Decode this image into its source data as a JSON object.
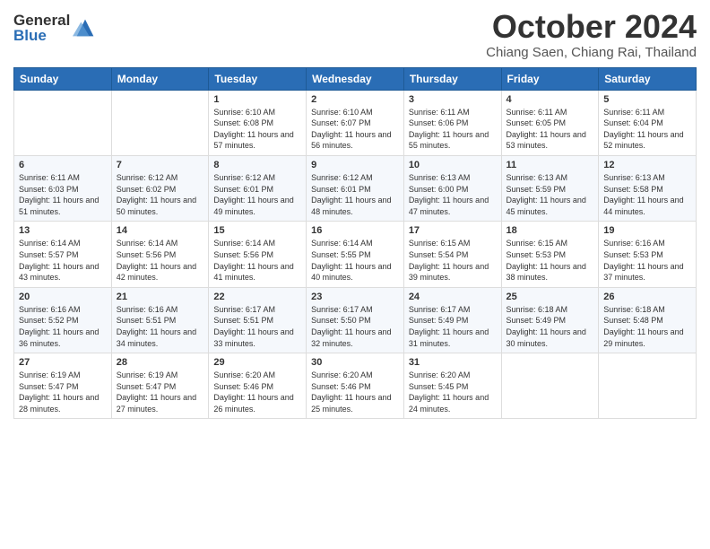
{
  "header": {
    "logo_general": "General",
    "logo_blue": "Blue",
    "month_title": "October 2024",
    "location": "Chiang Saen, Chiang Rai, Thailand"
  },
  "weekdays": [
    "Sunday",
    "Monday",
    "Tuesday",
    "Wednesday",
    "Thursday",
    "Friday",
    "Saturday"
  ],
  "weeks": [
    [
      {
        "day": "",
        "sunrise": "",
        "sunset": "",
        "daylight": ""
      },
      {
        "day": "",
        "sunrise": "",
        "sunset": "",
        "daylight": ""
      },
      {
        "day": "1",
        "sunrise": "Sunrise: 6:10 AM",
        "sunset": "Sunset: 6:08 PM",
        "daylight": "Daylight: 11 hours and 57 minutes."
      },
      {
        "day": "2",
        "sunrise": "Sunrise: 6:10 AM",
        "sunset": "Sunset: 6:07 PM",
        "daylight": "Daylight: 11 hours and 56 minutes."
      },
      {
        "day": "3",
        "sunrise": "Sunrise: 6:11 AM",
        "sunset": "Sunset: 6:06 PM",
        "daylight": "Daylight: 11 hours and 55 minutes."
      },
      {
        "day": "4",
        "sunrise": "Sunrise: 6:11 AM",
        "sunset": "Sunset: 6:05 PM",
        "daylight": "Daylight: 11 hours and 53 minutes."
      },
      {
        "day": "5",
        "sunrise": "Sunrise: 6:11 AM",
        "sunset": "Sunset: 6:04 PM",
        "daylight": "Daylight: 11 hours and 52 minutes."
      }
    ],
    [
      {
        "day": "6",
        "sunrise": "Sunrise: 6:11 AM",
        "sunset": "Sunset: 6:03 PM",
        "daylight": "Daylight: 11 hours and 51 minutes."
      },
      {
        "day": "7",
        "sunrise": "Sunrise: 6:12 AM",
        "sunset": "Sunset: 6:02 PM",
        "daylight": "Daylight: 11 hours and 50 minutes."
      },
      {
        "day": "8",
        "sunrise": "Sunrise: 6:12 AM",
        "sunset": "Sunset: 6:01 PM",
        "daylight": "Daylight: 11 hours and 49 minutes."
      },
      {
        "day": "9",
        "sunrise": "Sunrise: 6:12 AM",
        "sunset": "Sunset: 6:01 PM",
        "daylight": "Daylight: 11 hours and 48 minutes."
      },
      {
        "day": "10",
        "sunrise": "Sunrise: 6:13 AM",
        "sunset": "Sunset: 6:00 PM",
        "daylight": "Daylight: 11 hours and 47 minutes."
      },
      {
        "day": "11",
        "sunrise": "Sunrise: 6:13 AM",
        "sunset": "Sunset: 5:59 PM",
        "daylight": "Daylight: 11 hours and 45 minutes."
      },
      {
        "day": "12",
        "sunrise": "Sunrise: 6:13 AM",
        "sunset": "Sunset: 5:58 PM",
        "daylight": "Daylight: 11 hours and 44 minutes."
      }
    ],
    [
      {
        "day": "13",
        "sunrise": "Sunrise: 6:14 AM",
        "sunset": "Sunset: 5:57 PM",
        "daylight": "Daylight: 11 hours and 43 minutes."
      },
      {
        "day": "14",
        "sunrise": "Sunrise: 6:14 AM",
        "sunset": "Sunset: 5:56 PM",
        "daylight": "Daylight: 11 hours and 42 minutes."
      },
      {
        "day": "15",
        "sunrise": "Sunrise: 6:14 AM",
        "sunset": "Sunset: 5:56 PM",
        "daylight": "Daylight: 11 hours and 41 minutes."
      },
      {
        "day": "16",
        "sunrise": "Sunrise: 6:14 AM",
        "sunset": "Sunset: 5:55 PM",
        "daylight": "Daylight: 11 hours and 40 minutes."
      },
      {
        "day": "17",
        "sunrise": "Sunrise: 6:15 AM",
        "sunset": "Sunset: 5:54 PM",
        "daylight": "Daylight: 11 hours and 39 minutes."
      },
      {
        "day": "18",
        "sunrise": "Sunrise: 6:15 AM",
        "sunset": "Sunset: 5:53 PM",
        "daylight": "Daylight: 11 hours and 38 minutes."
      },
      {
        "day": "19",
        "sunrise": "Sunrise: 6:16 AM",
        "sunset": "Sunset: 5:53 PM",
        "daylight": "Daylight: 11 hours and 37 minutes."
      }
    ],
    [
      {
        "day": "20",
        "sunrise": "Sunrise: 6:16 AM",
        "sunset": "Sunset: 5:52 PM",
        "daylight": "Daylight: 11 hours and 36 minutes."
      },
      {
        "day": "21",
        "sunrise": "Sunrise: 6:16 AM",
        "sunset": "Sunset: 5:51 PM",
        "daylight": "Daylight: 11 hours and 34 minutes."
      },
      {
        "day": "22",
        "sunrise": "Sunrise: 6:17 AM",
        "sunset": "Sunset: 5:51 PM",
        "daylight": "Daylight: 11 hours and 33 minutes."
      },
      {
        "day": "23",
        "sunrise": "Sunrise: 6:17 AM",
        "sunset": "Sunset: 5:50 PM",
        "daylight": "Daylight: 11 hours and 32 minutes."
      },
      {
        "day": "24",
        "sunrise": "Sunrise: 6:17 AM",
        "sunset": "Sunset: 5:49 PM",
        "daylight": "Daylight: 11 hours and 31 minutes."
      },
      {
        "day": "25",
        "sunrise": "Sunrise: 6:18 AM",
        "sunset": "Sunset: 5:49 PM",
        "daylight": "Daylight: 11 hours and 30 minutes."
      },
      {
        "day": "26",
        "sunrise": "Sunrise: 6:18 AM",
        "sunset": "Sunset: 5:48 PM",
        "daylight": "Daylight: 11 hours and 29 minutes."
      }
    ],
    [
      {
        "day": "27",
        "sunrise": "Sunrise: 6:19 AM",
        "sunset": "Sunset: 5:47 PM",
        "daylight": "Daylight: 11 hours and 28 minutes."
      },
      {
        "day": "28",
        "sunrise": "Sunrise: 6:19 AM",
        "sunset": "Sunset: 5:47 PM",
        "daylight": "Daylight: 11 hours and 27 minutes."
      },
      {
        "day": "29",
        "sunrise": "Sunrise: 6:20 AM",
        "sunset": "Sunset: 5:46 PM",
        "daylight": "Daylight: 11 hours and 26 minutes."
      },
      {
        "day": "30",
        "sunrise": "Sunrise: 6:20 AM",
        "sunset": "Sunset: 5:46 PM",
        "daylight": "Daylight: 11 hours and 25 minutes."
      },
      {
        "day": "31",
        "sunrise": "Sunrise: 6:20 AM",
        "sunset": "Sunset: 5:45 PM",
        "daylight": "Daylight: 11 hours and 24 minutes."
      },
      {
        "day": "",
        "sunrise": "",
        "sunset": "",
        "daylight": ""
      },
      {
        "day": "",
        "sunrise": "",
        "sunset": "",
        "daylight": ""
      }
    ]
  ]
}
